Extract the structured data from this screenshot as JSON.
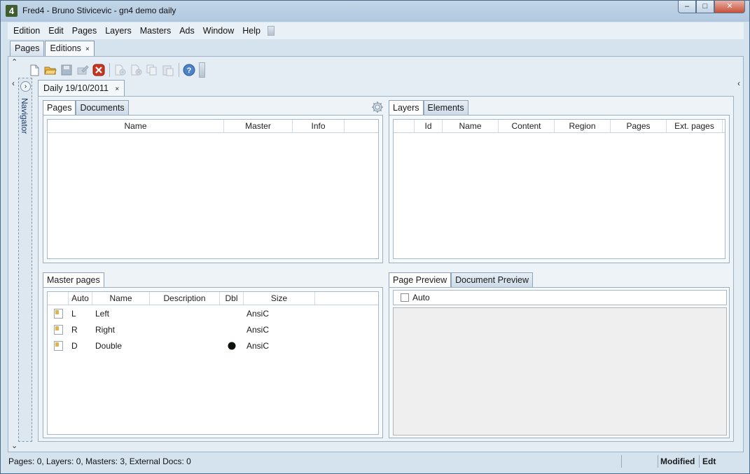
{
  "window": {
    "title": "Fred4 - Bruno Stivicevic - gn4 demo daily",
    "app_icon": "4",
    "minimize": "–",
    "maximize": "□",
    "close": "✕"
  },
  "menu": {
    "items": [
      "Edition",
      "Edit",
      "Pages",
      "Layers",
      "Masters",
      "Ads",
      "Window",
      "Help"
    ]
  },
  "top_tabs": {
    "pages": "Pages",
    "editions": "Editions",
    "close": "×"
  },
  "toolbar": {
    "icons": [
      "new-doc-icon",
      "open-folder-icon",
      "save-icon",
      "edit-disabled-icon",
      "delete-icon",
      "add-page-icon",
      "remove-page-icon",
      "copy-icon",
      "paste-icon",
      "help-icon"
    ]
  },
  "navigator": {
    "label": "Navigator",
    "toggle": "›"
  },
  "edition_tab": {
    "label": "Daily 19/10/2011",
    "close": "×"
  },
  "pages_panel": {
    "tabs": [
      "Pages",
      "Documents"
    ],
    "columns": [
      "Name",
      "Master",
      "Info"
    ]
  },
  "layers_panel": {
    "tabs": [
      "Layers",
      "Elements"
    ],
    "columns": [
      "Id",
      "Name",
      "Content",
      "Region",
      "Pages",
      "Ext. pages"
    ]
  },
  "masters_panel": {
    "tab": "Master pages",
    "columns": [
      "Auto",
      "Name",
      "Description",
      "Dbl",
      "Size"
    ],
    "rows": [
      {
        "auto": "L",
        "name": "Left",
        "description": "",
        "dbl": false,
        "size": "AnsiC"
      },
      {
        "auto": "R",
        "name": "Right",
        "description": "",
        "dbl": false,
        "size": "AnsiC"
      },
      {
        "auto": "D",
        "name": "Double",
        "description": "",
        "dbl": true,
        "size": "AnsiC"
      }
    ]
  },
  "preview_panel": {
    "tabs": [
      "Page Preview",
      "Document Preview"
    ],
    "auto_label": "Auto",
    "auto_checked": false
  },
  "status": {
    "summary": "Pages: 0, Layers: 0, Masters: 3, External Docs: 0",
    "modified": "Modified",
    "mode": "Edt"
  }
}
